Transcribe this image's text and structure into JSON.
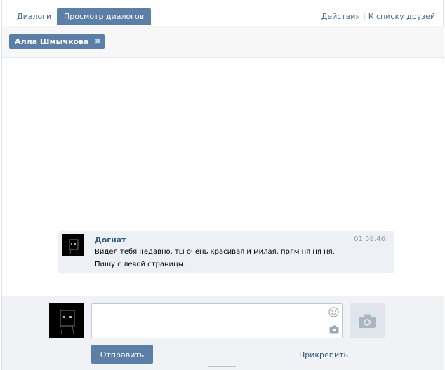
{
  "tabs": [
    {
      "label": "Диалоги",
      "active": false
    },
    {
      "label": "Просмотр диалогов",
      "active": true
    }
  ],
  "header_links": {
    "actions": "Действия",
    "separator": "|",
    "friends": "К списку друзей"
  },
  "participant": {
    "name": "Алла Шмычкова",
    "remove_glyph": "✖"
  },
  "message": {
    "author": "Догнат",
    "time": "01:58:46",
    "lines": [
      "Видел тебя недавно, ты очень красивая и милая, прям ня ня ня.",
      "Пишу с левой страницы."
    ]
  },
  "compose": {
    "input_value": "",
    "send_label": "Отправить",
    "attach_label": "Прикрепить",
    "icons": {
      "smile": "smile-icon",
      "photo_small": "camera-icon",
      "photo_big": "camera-icon"
    }
  },
  "colors": {
    "accent": "#5b7fa6",
    "link": "#2b587a",
    "message_bg": "#edf1f5",
    "compose_bg": "#f0f2f5"
  }
}
